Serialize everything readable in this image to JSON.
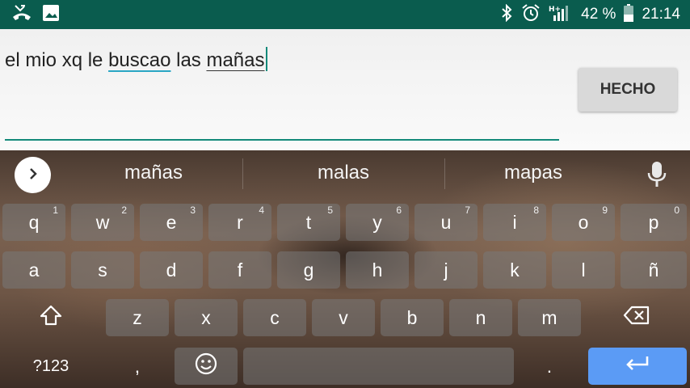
{
  "status_bar": {
    "icons_left": [
      "missed-call-icon",
      "image-icon"
    ],
    "icons_right": [
      "bluetooth-icon",
      "alarm-icon",
      "signal-hplus-icon",
      "battery-icon"
    ],
    "battery": "42 %",
    "time": "21:14"
  },
  "editor": {
    "text_parts": [
      "el mio xq le ",
      "buscao",
      " las ",
      "mañas"
    ],
    "done_label": "HECHO"
  },
  "keyboard": {
    "suggestions": [
      "mañas",
      "malas",
      "mapas"
    ],
    "row1": [
      {
        "label": "q",
        "hint": "1"
      },
      {
        "label": "w",
        "hint": "2"
      },
      {
        "label": "e",
        "hint": "3"
      },
      {
        "label": "r",
        "hint": "4"
      },
      {
        "label": "t",
        "hint": "5"
      },
      {
        "label": "y",
        "hint": "6"
      },
      {
        "label": "u",
        "hint": "7"
      },
      {
        "label": "i",
        "hint": "8"
      },
      {
        "label": "o",
        "hint": "9"
      },
      {
        "label": "p",
        "hint": "0"
      }
    ],
    "row2": [
      "a",
      "s",
      "d",
      "f",
      "g",
      "h",
      "j",
      "k",
      "l",
      "ñ"
    ],
    "row3": [
      "z",
      "x",
      "c",
      "v",
      "b",
      "n",
      "m"
    ],
    "symbols_label": "?123",
    "comma_label": ",",
    "period_label": ".",
    "accent_color": "#5b9bf5"
  }
}
